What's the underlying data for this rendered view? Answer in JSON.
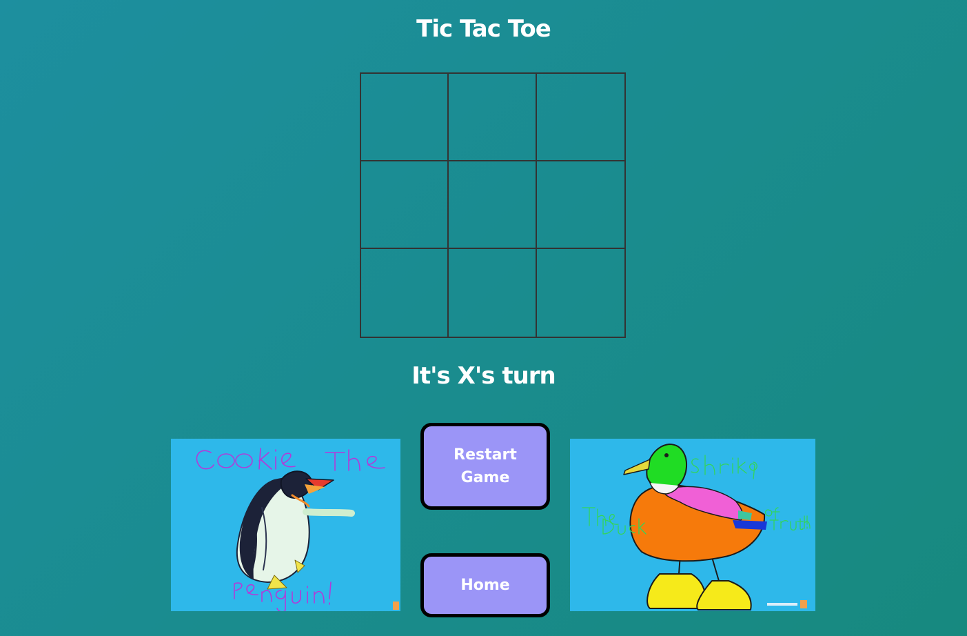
{
  "title": "Tic Tac Toe",
  "board": {
    "cells": [
      "",
      "",
      "",
      "",
      "",
      "",
      "",
      "",
      ""
    ]
  },
  "status_text": "It's X's turn",
  "buttons": {
    "restart_label": "Restart Game",
    "home_label": "Home"
  },
  "drawings": {
    "left": {
      "caption_top": "Cookie The",
      "caption_bottom": "Penguin!",
      "subject": "penguin"
    },
    "right": {
      "caption_name": "Shrik9",
      "caption_left": "The Duck",
      "caption_right": "of Truth!",
      "subject": "duck"
    }
  },
  "colors": {
    "button_fill": "#9b95f7",
    "drawing_background": "#2eb8ea",
    "grid_line": "#333333"
  }
}
